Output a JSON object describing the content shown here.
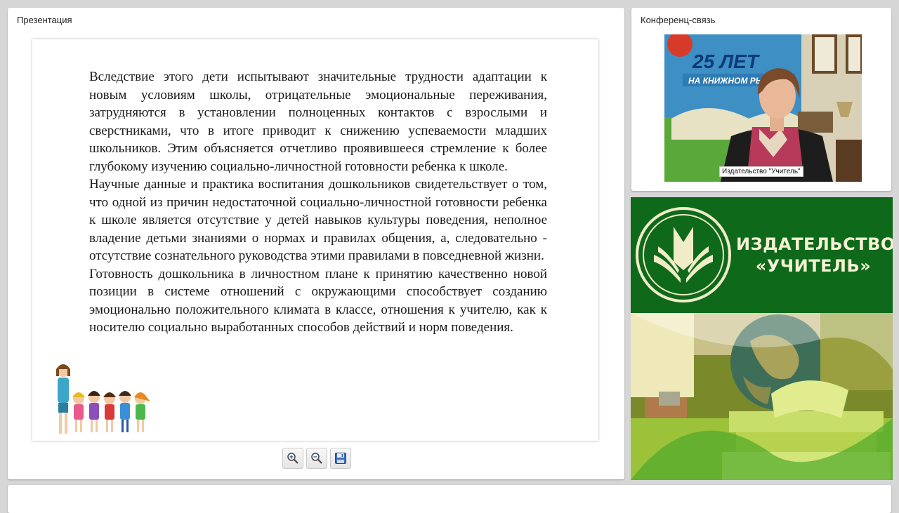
{
  "presentation": {
    "title": "Презентация",
    "paragraphs": [
      "Вследствие этого дети испытывают значительные трудности адаптации к новым условиям школы, отрицательные эмоциональные переживания, затрудняются в установлении полноценных контактов с взрослыми и сверстниками, что в итоге приводит к снижению успеваемости младших школьников. Этим объясняется отчетливо проявившееся стремление к более глубокому изучению социально-личностной готовности ребенка к школе.",
      "Научные данные и практика воспитания дошкольников свидетельствует о том, что одной из причин недостаточной социально-личностной готовности ребенка к школе является отсутствие у детей навыков культуры поведения, неполное владение детьми знаниями о нормах и правилах общения, а, следовательно - отсутствие сознательного руководства этими правилами в повседневной жизни.",
      "Готовность дошкольника в личностном плане к принятию качественно новой позиции в системе отношений с окружающими способствует созданию эмоционально положительного климата в классе, отношения к учителю, как к носителю социально выработанных способов действий и норм поведения."
    ],
    "toolbar": {
      "zoom_in_icon": "zoom-in-icon",
      "zoom_out_icon": "zoom-out-icon",
      "save_icon": "save-icon"
    }
  },
  "conference": {
    "title": "Конференц-связь",
    "video_caption": "Издательство \"Учитель\"",
    "banner_line1": "25 ЛЕТ",
    "banner_line2": "НА КНИЖНОМ РЫ..."
  },
  "brand": {
    "name_line1": "ИЗДАТЕЛЬСТВО",
    "name_line2": "«УЧИТЕЛЬ»",
    "color": "#0e6a1a"
  }
}
